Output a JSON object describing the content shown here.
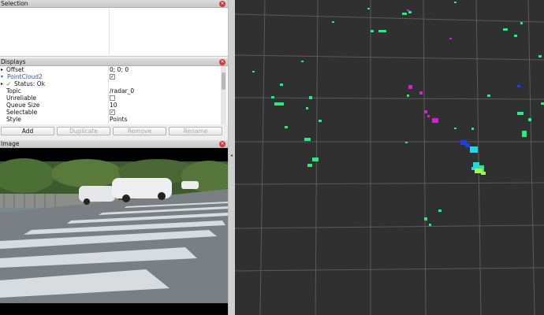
{
  "selection_panel": {
    "title": "Selection"
  },
  "displays_panel": {
    "title": "Displays",
    "rows": [
      {
        "key": "Offset",
        "value": "0; 0; 0"
      },
      {
        "key": "PointCloud2",
        "value": ""
      },
      {
        "key": "Status: Ok",
        "value": ""
      },
      {
        "key": "Topic",
        "value": "/radar_0"
      },
      {
        "key": "Unreliable",
        "value": ""
      },
      {
        "key": "Queue Size",
        "value": "10"
      },
      {
        "key": "Selectable",
        "value": ""
      },
      {
        "key": "Style",
        "value": "Points"
      }
    ],
    "pointcloud_enabled": true,
    "unreliable_checked": false,
    "selectable_checked": true,
    "buttons": {
      "add": "Add",
      "duplicate": "Duplicate",
      "remove": "Remove",
      "rename": "Rename"
    }
  },
  "image_panel": {
    "title": "Image"
  },
  "icons": {
    "close": "close-icon",
    "expand": "triangle-right-icon",
    "pointcloud": "pointcloud-icon",
    "status_ok": "checkmark-icon",
    "splitter": "chevron-left-icon"
  },
  "colors": {
    "viewport_bg": "#303030",
    "grid": "#5a5a5a",
    "point_green": "#2ee87c",
    "point_magenta": "#d21fd8",
    "point_blue": "#1f3fe0",
    "point_cyan": "#22d8e8",
    "close_red": "#d33a3a"
  }
}
